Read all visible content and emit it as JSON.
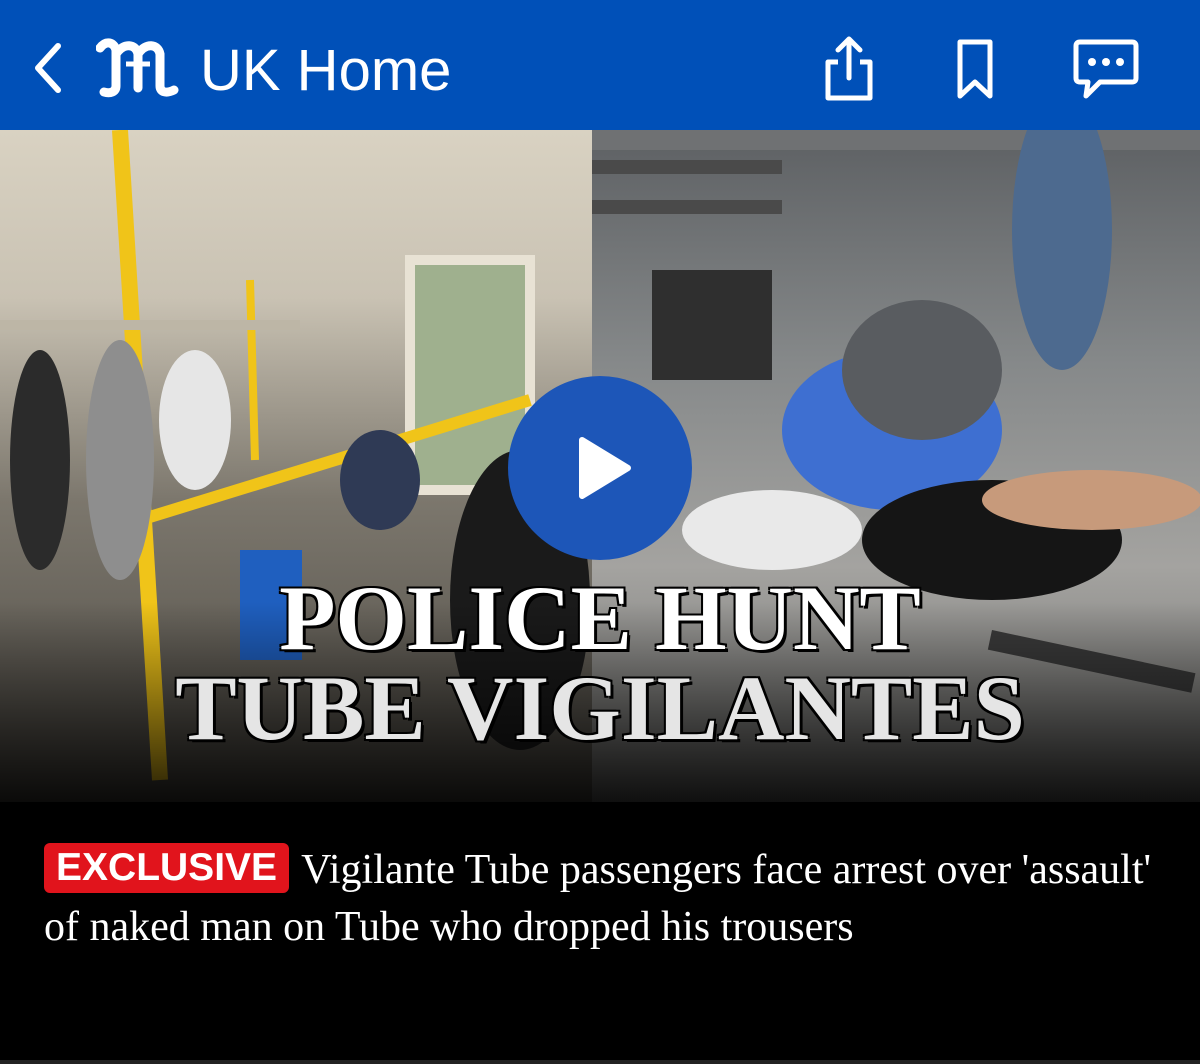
{
  "header": {
    "title": "UK Home",
    "icons": [
      "back-chevron-icon",
      "daily-mail-logo",
      "share-icon",
      "bookmark-icon",
      "comments-icon"
    ]
  },
  "media": {
    "overlay_line_1": "POLICE HUNT",
    "overlay_line_2": "TUBE VIGILANTES",
    "play_icon": "play-icon"
  },
  "article": {
    "badge": "EXCLUSIVE",
    "headline": "Vigilante Tube passengers face arrest over 'assault' of naked man on Tube who dropped his trousers"
  },
  "colors": {
    "header_bg": "#0050b8",
    "badge_bg": "#e1141c",
    "play_bg": "#1d56b8",
    "page_bg": "#000000"
  }
}
